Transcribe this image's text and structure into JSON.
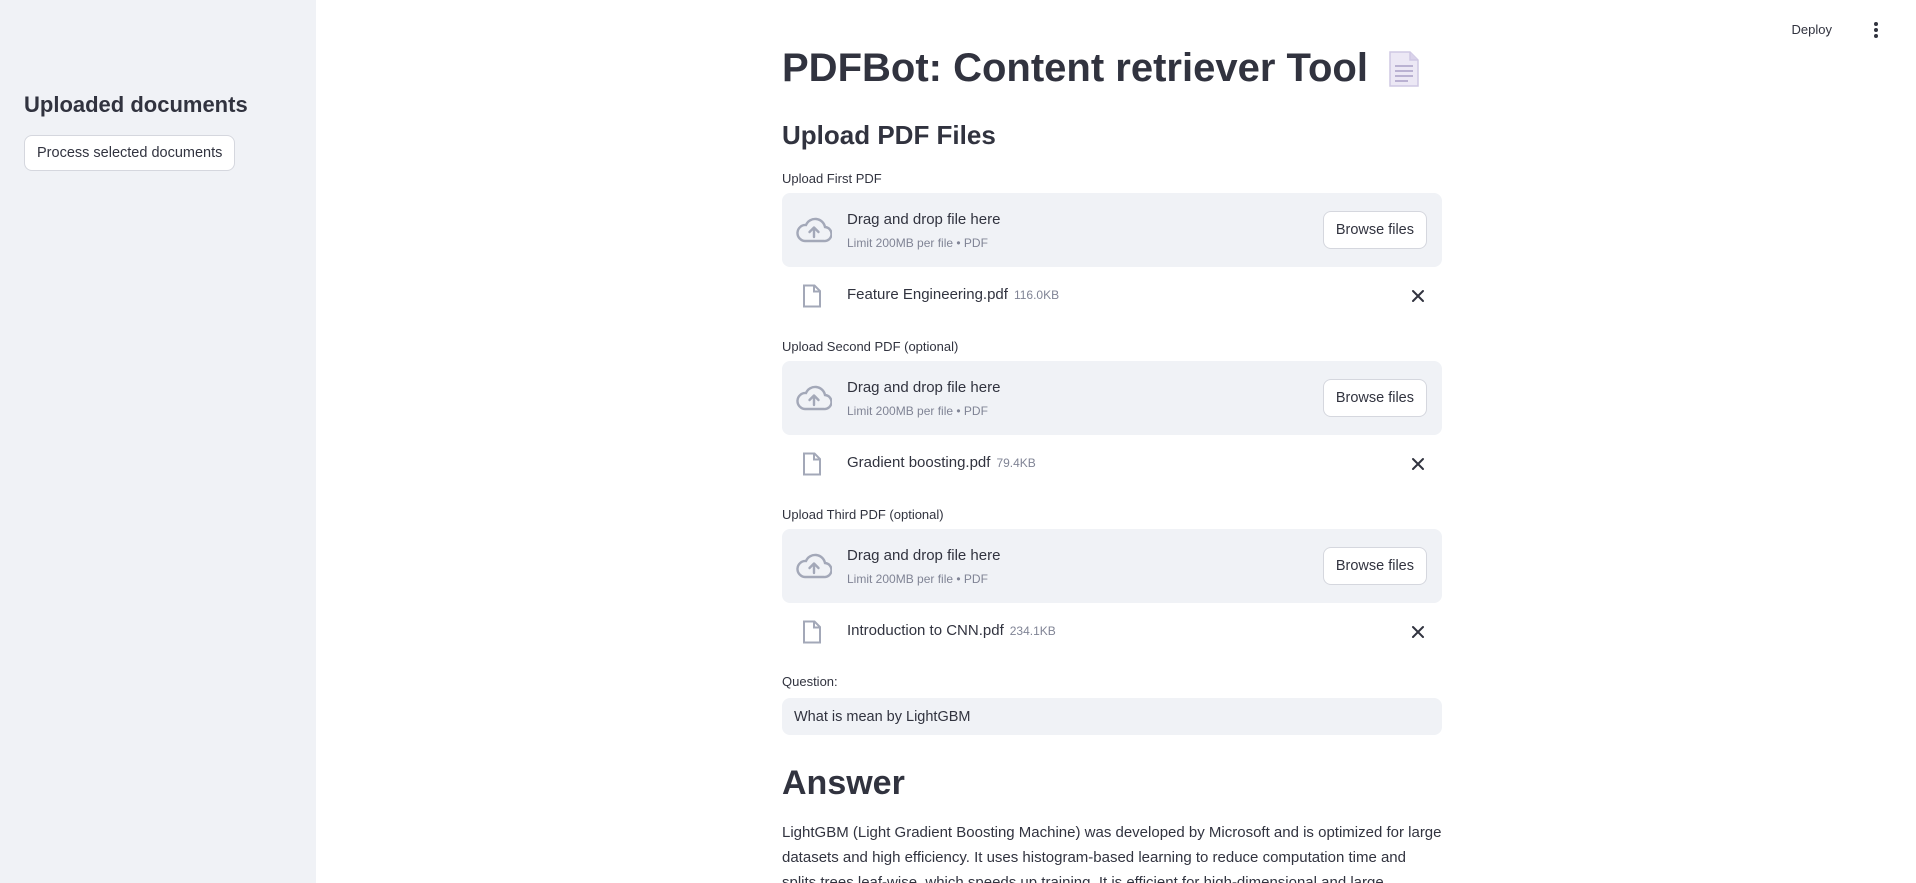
{
  "sidebar": {
    "title": "Uploaded documents",
    "process_button": "Process selected documents"
  },
  "topbar": {
    "deploy_label": "Deploy"
  },
  "main": {
    "title": "PDFBot: Content retriever Tool",
    "section_title": "Upload PDF Files",
    "uploaders": [
      {
        "label": "Upload First PDF",
        "drop_text": "Drag and drop file here",
        "limit_text": "Limit 200MB per file • PDF",
        "browse_label": "Browse files",
        "file_name": "Feature Engineering.pdf",
        "file_size": "116.0KB"
      },
      {
        "label": "Upload Second PDF (optional)",
        "drop_text": "Drag and drop file here",
        "limit_text": "Limit 200MB per file • PDF",
        "browse_label": "Browse files",
        "file_name": "Gradient boosting.pdf",
        "file_size": "79.4KB"
      },
      {
        "label": "Upload Third PDF (optional)",
        "drop_text": "Drag and drop file here",
        "limit_text": "Limit 200MB per file • PDF",
        "browse_label": "Browse files",
        "file_name": "Introduction to CNN.pdf",
        "file_size": "234.1KB"
      }
    ],
    "question_label": "Question:",
    "question_value": "What is mean by LightGBM",
    "answer_title": "Answer",
    "answer_text": "LightGBM (Light Gradient Boosting Machine) was developed by Microsoft and is optimized for large datasets and high efficiency. It uses histogram-based learning to reduce computation time and splits trees leaf-wise, which speeds up training. It is efficient for high-dimensional and large datasets and has lower"
  },
  "colors": {
    "sidebar_bg": "#f0f2f6",
    "text": "#31333f",
    "muted": "#808495",
    "icon": "#a3a8b8"
  },
  "icons": {
    "upload": "cloud-upload-icon",
    "file": "file-icon",
    "remove": "close-icon",
    "menu": "kebab-menu-icon",
    "title_emoji": "page-facing-up-icon"
  }
}
